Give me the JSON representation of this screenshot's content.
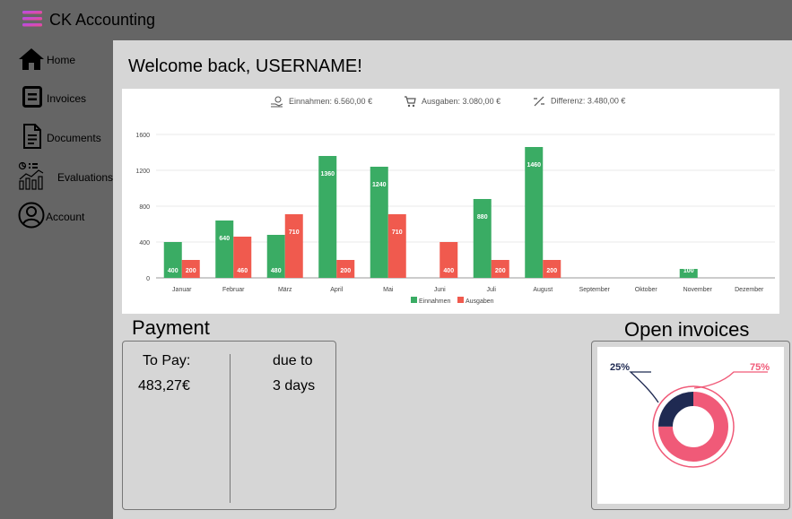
{
  "app": {
    "name": "CK Accounting"
  },
  "nav": [
    {
      "label": "Home",
      "icon": "home-icon"
    },
    {
      "label": "Invoices",
      "icon": "invoice-icon"
    },
    {
      "label": "Documents",
      "icon": "document-icon"
    },
    {
      "label": "Evaluations",
      "icon": "evaluations-icon"
    },
    {
      "label": "Account",
      "icon": "account-icon"
    }
  ],
  "welcome": "Welcome back, USERNAME!",
  "kpis": {
    "income": "Einnahmen: 6.560,00 €",
    "expenses": "Ausgaben: 3.080,00 €",
    "difference": "Differenz: 3.480,00 €"
  },
  "payment": {
    "title": "Payment",
    "to_pay_label": "To Pay:",
    "amount": "483,27€",
    "due_label": "due to",
    "due_value": "3 days"
  },
  "open_invoices": {
    "title": "Open invoices",
    "left_label": "25%",
    "right_label": "75%",
    "colors": {
      "left": "#1f2a52",
      "right": "#f05a78"
    }
  },
  "chart_data": {
    "type": "bar",
    "categories": [
      "Januar",
      "Februar",
      "März",
      "April",
      "Mai",
      "Juni",
      "Juli",
      "August",
      "September",
      "Oktober",
      "November",
      "Dezember"
    ],
    "series": [
      {
        "name": "Einnahmen",
        "color": "#3aac64",
        "values": [
          400,
          640,
          480,
          1360,
          1240,
          0,
          880,
          1460,
          0,
          0,
          100,
          0
        ]
      },
      {
        "name": "Ausgaben",
        "color": "#f05a4e",
        "values": [
          200,
          460,
          710,
          200,
          710,
          400,
          200,
          200,
          0,
          0,
          0,
          0
        ]
      }
    ],
    "yticks": [
      0,
      400,
      800,
      1200,
      1600
    ],
    "ylim": [
      0,
      1600
    ],
    "grid": true,
    "legend": "bottom"
  }
}
